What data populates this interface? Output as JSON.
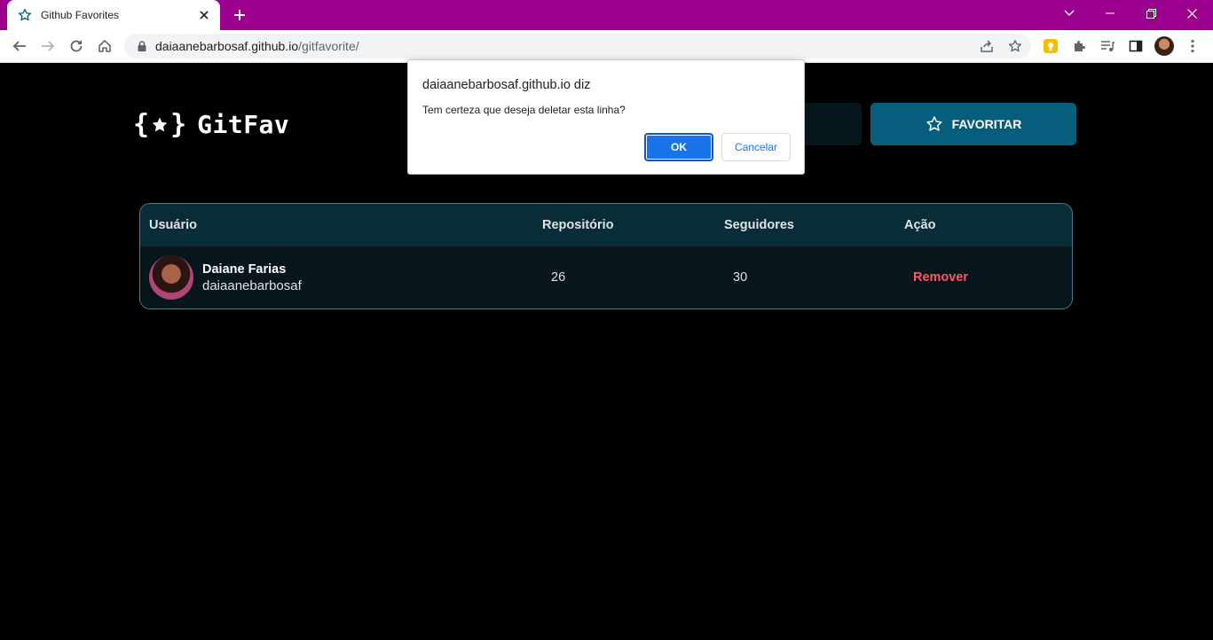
{
  "browser": {
    "tab_title": "Github Favorites",
    "url_host": "daiaanebarbosaf.github.io",
    "url_path": "/gitfavorite/"
  },
  "app": {
    "logo_mark_left": "{",
    "logo_mark_right": "}",
    "logo_text": "GitFav",
    "search_placeholder": "",
    "favorite_button_label": "FAVORITAR"
  },
  "table": {
    "headers": [
      "Usuário",
      "Repositório",
      "Seguidores",
      "Ação"
    ],
    "rows": [
      {
        "name": "Daiane Farias",
        "login": "daiaanebarbosaf",
        "repositories": "26",
        "followers": "30",
        "action": "Remover"
      }
    ]
  },
  "dialog": {
    "title": "daiaanebarbosaf.github.io diz",
    "message": "Tem certeza que deseja deletar esta linha?",
    "ok_label": "OK",
    "cancel_label": "Cancelar"
  },
  "colors": {
    "titlebar": "#9b008f",
    "favorite_button": "#065e7c",
    "table_header": "#092d38",
    "table_row": "#06161b",
    "remove_text": "#f75a68",
    "dialog_ok": "#1a73e8"
  }
}
